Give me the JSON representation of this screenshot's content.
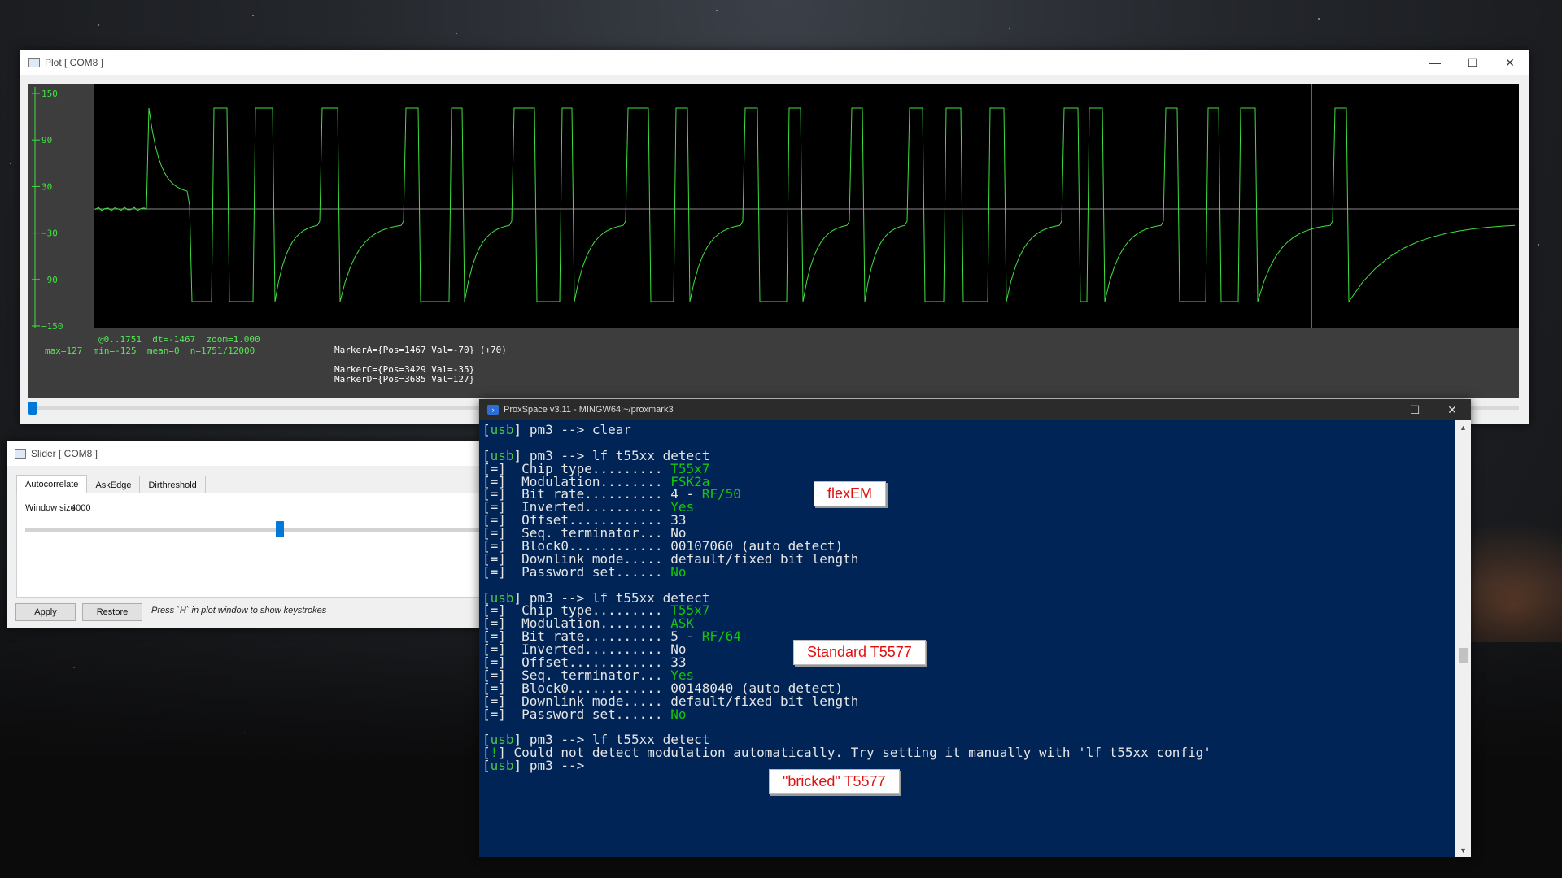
{
  "plot_window": {
    "title": "Plot [ COM8 ]",
    "y_ticks": [
      "150",
      "90",
      "30",
      "−30",
      "−90",
      "−150"
    ],
    "info_line": "@0..1751  dt=-1467  zoom=1.000",
    "stats_line": "max=127  min=-125  mean=0  n=1751/12000",
    "marker_a": "MarkerA={Pos=1467 Val=-70} (+70)",
    "marker_c": "MarkerC={Pos=3429 Val=-35}",
    "marker_d": "MarkerD={Pos=3685 Val=127}",
    "colors": {
      "trace": "#3fe13f",
      "axis": "#3fe13f",
      "marker": "#ffd700",
      "background": "#000000"
    }
  },
  "slider_window": {
    "title": "Slider [ COM8 ]",
    "tabs": [
      "Autocorrelate",
      "AskEdge",
      "Dirthreshold"
    ],
    "window_size_label": "Window size",
    "window_size_value": "4000",
    "slider_fraction": 0.55,
    "apply_label": "Apply",
    "restore_label": "Restore",
    "hint": "Press `H` in plot window to show keystrokes"
  },
  "console_window": {
    "title": "ProxSpace v3.11 - MINGW64:~/proxmark3",
    "lines": [
      [
        {
          "t": "[",
          "c": "dim"
        },
        {
          "t": "usb",
          "c": "usb"
        },
        {
          "t": "] pm3 --> clear",
          "c": "dim"
        }
      ],
      [],
      [
        {
          "t": "[",
          "c": "dim"
        },
        {
          "t": "usb",
          "c": "usb"
        },
        {
          "t": "] pm3 --> lf t55xx detect",
          "c": "dim"
        }
      ],
      [
        {
          "t": "[=]  Chip type......... ",
          "c": "dim"
        },
        {
          "t": "T55x7",
          "c": "green"
        }
      ],
      [
        {
          "t": "[=]  Modulation........ ",
          "c": "dim"
        },
        {
          "t": "FSK2a",
          "c": "green"
        }
      ],
      [
        {
          "t": "[=]  Bit rate.......... 4 - ",
          "c": "dim"
        },
        {
          "t": "RF/50",
          "c": "green"
        }
      ],
      [
        {
          "t": "[=]  Inverted.......... ",
          "c": "dim"
        },
        {
          "t": "Yes",
          "c": "green"
        }
      ],
      [
        {
          "t": "[=]  Offset............ 33",
          "c": "dim"
        }
      ],
      [
        {
          "t": "[=]  Seq. terminator... No",
          "c": "dim"
        }
      ],
      [
        {
          "t": "[=]  Block0............ 00107060 (auto detect)",
          "c": "dim"
        }
      ],
      [
        {
          "t": "[=]  Downlink mode..... default/fixed bit length",
          "c": "dim"
        }
      ],
      [
        {
          "t": "[=]  Password set...... ",
          "c": "dim"
        },
        {
          "t": "No",
          "c": "green"
        }
      ],
      [],
      [
        {
          "t": "[",
          "c": "dim"
        },
        {
          "t": "usb",
          "c": "usb"
        },
        {
          "t": "] pm3 --> lf t55xx detect",
          "c": "dim"
        }
      ],
      [
        {
          "t": "[=]  Chip type......... ",
          "c": "dim"
        },
        {
          "t": "T55x7",
          "c": "green"
        }
      ],
      [
        {
          "t": "[=]  Modulation........ ",
          "c": "dim"
        },
        {
          "t": "ASK",
          "c": "green"
        }
      ],
      [
        {
          "t": "[=]  Bit rate.......... 5 - ",
          "c": "dim"
        },
        {
          "t": "RF/64",
          "c": "green"
        }
      ],
      [
        {
          "t": "[=]  Inverted.......... No",
          "c": "dim"
        }
      ],
      [
        {
          "t": "[=]  Offset............ 33",
          "c": "dim"
        }
      ],
      [
        {
          "t": "[=]  Seq. terminator... ",
          "c": "dim"
        },
        {
          "t": "Yes",
          "c": "green"
        }
      ],
      [
        {
          "t": "[=]  Block0............ 00148040 (auto detect)",
          "c": "dim"
        }
      ],
      [
        {
          "t": "[=]  Downlink mode..... default/fixed bit length",
          "c": "dim"
        }
      ],
      [
        {
          "t": "[=]  Password set...... ",
          "c": "dim"
        },
        {
          "t": "No",
          "c": "green"
        }
      ],
      [],
      [
        {
          "t": "[",
          "c": "dim"
        },
        {
          "t": "usb",
          "c": "usb"
        },
        {
          "t": "] pm3 --> lf t55xx detect",
          "c": "dim"
        }
      ],
      [
        {
          "t": "[",
          "c": "dim"
        },
        {
          "t": "!",
          "c": "green"
        },
        {
          "t": "] Could not detect modulation automatically. Try setting it manually with 'lf t55xx config'",
          "c": "dim"
        }
      ],
      [
        {
          "t": "[",
          "c": "dim"
        },
        {
          "t": "usb",
          "c": "usb"
        },
        {
          "t": "] pm3 -->",
          "c": "dim"
        }
      ]
    ]
  },
  "callouts": {
    "flexem": "flexEM",
    "standard": "Standard T5577",
    "bricked": "\"bricked\" T5577"
  },
  "window_controls": {
    "minimize": "—",
    "maximize": "☐",
    "close": "✕"
  }
}
